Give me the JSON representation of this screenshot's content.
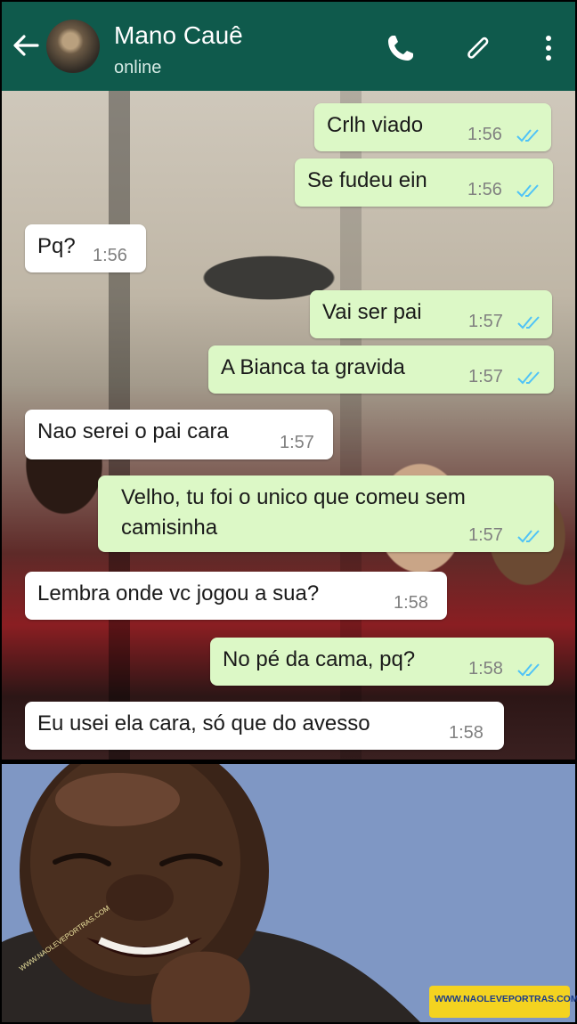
{
  "header": {
    "contact_name": "Mano Cauê",
    "contact_status": "online",
    "colors": {
      "bar": "#0f5a4c",
      "title": "#ffffff"
    },
    "icons": [
      "back-arrow-icon",
      "phone-icon",
      "paperclip-icon",
      "more-vertical-icon"
    ]
  },
  "chat": {
    "colors": {
      "outgoing_bubble": "#dcf8c6",
      "incoming_bubble": "#ffffff",
      "read_tick": "#4fc3f7"
    },
    "messages": [
      {
        "dir": "out",
        "text": "Crlh viado",
        "time": "1:56",
        "read": true
      },
      {
        "dir": "out",
        "text": "Se fudeu ein",
        "time": "1:56",
        "read": true
      },
      {
        "dir": "in",
        "text": "Pq?",
        "time": "1:56"
      },
      {
        "dir": "out",
        "text": "Vai ser pai",
        "time": "1:57",
        "read": true
      },
      {
        "dir": "out",
        "text": "A Bianca ta gravida",
        "time": "1:57",
        "read": true
      },
      {
        "dir": "in",
        "text": "Nao serei o pai cara",
        "time": "1:57"
      },
      {
        "dir": "out",
        "text": "Velho, tu foi o unico que comeu sem",
        "text2": "camisinha",
        "time": "1:57",
        "read": true
      },
      {
        "dir": "in",
        "text": "Lembra onde vc jogou a sua?",
        "time": "1:58"
      },
      {
        "dir": "out",
        "text": "No pé da cama, pq?",
        "time": "1:58",
        "read": true
      },
      {
        "dir": "in",
        "text": "Eu usei ela cara, só que do avesso",
        "time": "1:58"
      }
    ]
  },
  "reaction_image": {
    "watermark": "WWW.NAOLEVEPORTRAS.COM",
    "watermark_small": "WWW.NAOLEVEPORTRAS.COM"
  }
}
